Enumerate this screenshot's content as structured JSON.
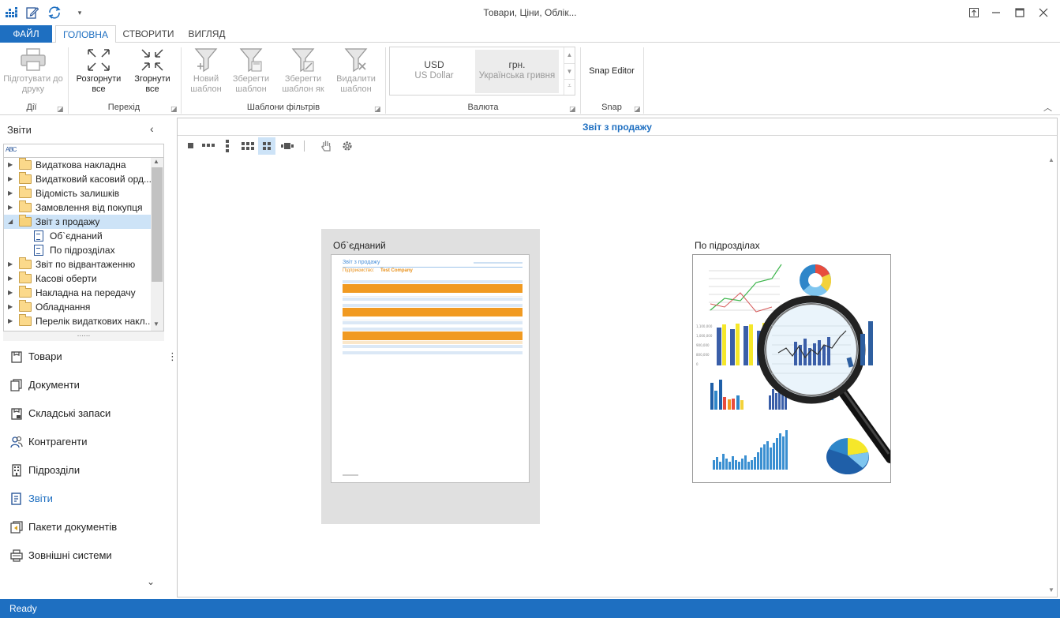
{
  "window": {
    "title": "Товари, Ціни, Облік..."
  },
  "ribbon_tabs": [
    {
      "label": "ФАЙЛ"
    },
    {
      "label": "ГОЛОВНА"
    },
    {
      "label": "СТВОРИТИ"
    },
    {
      "label": "ВИГЛЯД"
    }
  ],
  "ribbon": {
    "print_prepare": "Підготувати до друку",
    "expand_all": "Розгорнути все",
    "collapse_all": "Згорнути все",
    "new_template": "Новий шаблон",
    "save_template": "Зберегти шаблон",
    "save_template_as": "Зберегти шаблон як",
    "delete_template": "Видалити шаблон",
    "snap_editor": "Snap Editor",
    "groups": {
      "actions": "Дії",
      "navigation": "Перехід",
      "filter_templates": "Шаблони фільтрів",
      "currency": "Валюта",
      "snap": "Snap"
    },
    "currencies": [
      {
        "code": "USD",
        "name": "US Dollar"
      },
      {
        "code": "грн.",
        "name": "Українська гривня"
      }
    ]
  },
  "left_pane": {
    "title": "Звіти",
    "search_icon_text": "ABC",
    "tree": [
      {
        "label": "Видаткова накладна",
        "type": "folder"
      },
      {
        "label": "Видатковий касовий орд...",
        "type": "folder"
      },
      {
        "label": "Відомість залишків",
        "type": "folder"
      },
      {
        "label": "Замовлення від покупця",
        "type": "folder"
      },
      {
        "label": "Звіт з продажу",
        "type": "folder-open",
        "selected": true
      },
      {
        "label": "Об`єднаний",
        "type": "report"
      },
      {
        "label": "По підрозділах",
        "type": "report"
      },
      {
        "label": "Звіт по відвантаженню",
        "type": "folder"
      },
      {
        "label": "Касові оберти",
        "type": "folder"
      },
      {
        "label": "Накладна на передачу",
        "type": "folder"
      },
      {
        "label": "Обладнання",
        "type": "folder"
      },
      {
        "label": "Перелік видаткових накл...",
        "type": "folder"
      }
    ],
    "nav": [
      {
        "label": "Товари",
        "icon": "goods-icon"
      },
      {
        "label": "Документи",
        "icon": "documents-icon"
      },
      {
        "label": "Складські запаси",
        "icon": "stock-icon"
      },
      {
        "label": "Контрагенти",
        "icon": "contractors-icon"
      },
      {
        "label": "Підрозділи",
        "icon": "departments-icon"
      },
      {
        "label": "Звіти",
        "icon": "reports-icon",
        "active": true
      },
      {
        "label": "Пакети документів",
        "icon": "packages-icon"
      },
      {
        "label": "Зовнішні системи",
        "icon": "external-systems-icon"
      }
    ]
  },
  "main": {
    "header": "Звіт з продажу",
    "reports": [
      {
        "label": "Об`єднаний"
      },
      {
        "label": "По підрозділах"
      }
    ],
    "thumb": {
      "title": "Звіт з продажу",
      "company_label": "Підприємство:",
      "company": "Test Company"
    }
  },
  "status": {
    "text": "Ready"
  },
  "colors": {
    "accent": "#1e6fc1",
    "selection": "#cde3f7"
  }
}
